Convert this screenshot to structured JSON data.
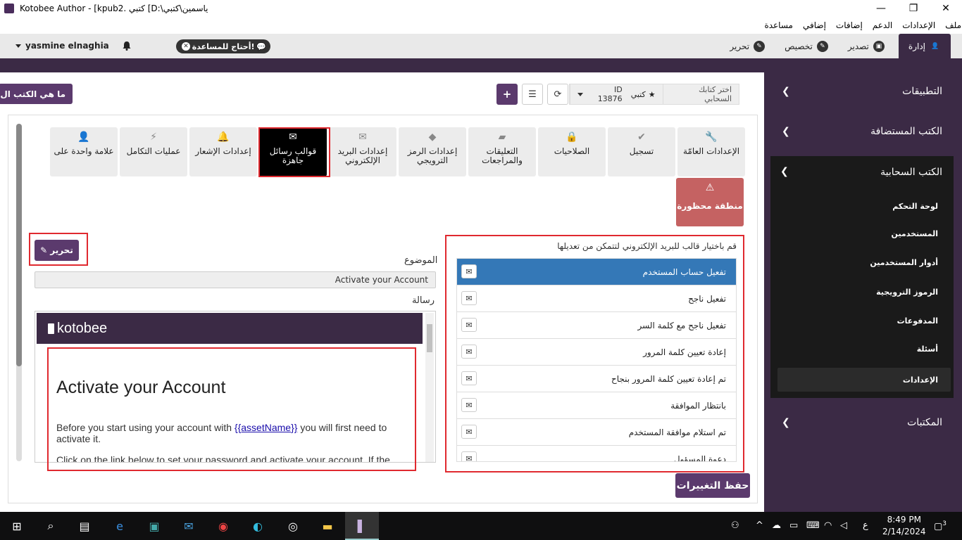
{
  "window": {
    "title": "Kotobee Author - [kpub2. كتبي [D:\\ياسمين\\كتبي",
    "minimize": "—",
    "maximize": "❐",
    "close": "✕"
  },
  "menu": [
    "ملف",
    "الإعدادات",
    "الدعم",
    "إضافات",
    "إضافي",
    "مساعدة"
  ],
  "appbar": {
    "user": "yasmine elnaghia",
    "help_text": "أحتاج للمساعدة!",
    "tabs": [
      {
        "label": "إدارة",
        "icon": "user-icon",
        "active": true
      },
      {
        "label": "تصدير",
        "icon": "export-icon",
        "active": false
      },
      {
        "label": "تخصيص",
        "icon": "brush-icon",
        "active": false
      },
      {
        "label": "تحرير",
        "icon": "pencil-icon",
        "active": false
      }
    ]
  },
  "sidebar": {
    "sections": [
      "التطبيقات",
      "الكتب المستضافة"
    ],
    "expanded": {
      "title": "الكتب السحابية",
      "items": [
        "لوحة التحكم",
        "المستخدمين",
        "أدوار المستخدمين",
        "الرموز الترويجية",
        "المدفوعات",
        "أسئلة",
        "الإعدادات"
      ],
      "active_index": 6
    },
    "libraries": "المكتبات"
  },
  "toolbar": {
    "whatis": "ما هي الكتب ال",
    "select_book_label": "اختر كتابك السحابي",
    "book_name": "كتبي",
    "book_id": "ID 13876"
  },
  "categories": [
    {
      "label": "الإعدادات العامّة",
      "icon": "wrench-icon"
    },
    {
      "label": "تسجيل",
      "icon": "check-icon"
    },
    {
      "label": "الصلاحيات",
      "icon": "lock-icon"
    },
    {
      "label": "التعليقات والمراجعات",
      "icon": "note-icon"
    },
    {
      "label": "إعدادات الرمز الترويجي",
      "icon": "tag-icon"
    },
    {
      "label": "إعدادات البريد الإلكتروني",
      "icon": "mail-icon"
    },
    {
      "label": "قوالب رسائل جاهزة",
      "icon": "mail-icon",
      "active": true
    },
    {
      "label": "إعدادات الإشعار",
      "icon": "bell-icon"
    },
    {
      "label": "عمليات التكامل",
      "icon": "plug-icon"
    },
    {
      "label": "علامة واحدة على",
      "icon": "user-icon"
    }
  ],
  "danger_zone": "منطقة محظورة",
  "editor": {
    "edit_label": "تحرير",
    "subject_label": "الموضوع",
    "subject_value": "Activate your Account",
    "message_label": "رسالة",
    "preview_logo": "kotobee",
    "preview_title": "Activate your Account",
    "preview_body_1": "Before you start using your account with ",
    "preview_link": "{{assetName}}",
    "preview_body_2": " you will first need to activate it.",
    "preview_body_3": "Click on the link below to set your password and activate your account. If the"
  },
  "templates": {
    "header": "قم باختيار قالب للبريد الإلكتروني لتتمكن من تعديلها",
    "items": [
      "تفعيل حساب المستخدم",
      "تفعيل ناجح",
      "تفعيل ناجح مع كلمة السر",
      "إعادة تعيين كلمة المرور",
      "تم إعادة تعيين كلمة المرور بنجاح",
      "بانتظار الموافقة",
      "تم استلام موافقة المستخدم",
      "دعوة المسؤول"
    ],
    "selected_index": 0
  },
  "save_label": "حفظ التغييرات",
  "taskbar": {
    "time": "8:49 PM",
    "date": "2/14/2024",
    "lang": "ع",
    "notif": "3"
  }
}
